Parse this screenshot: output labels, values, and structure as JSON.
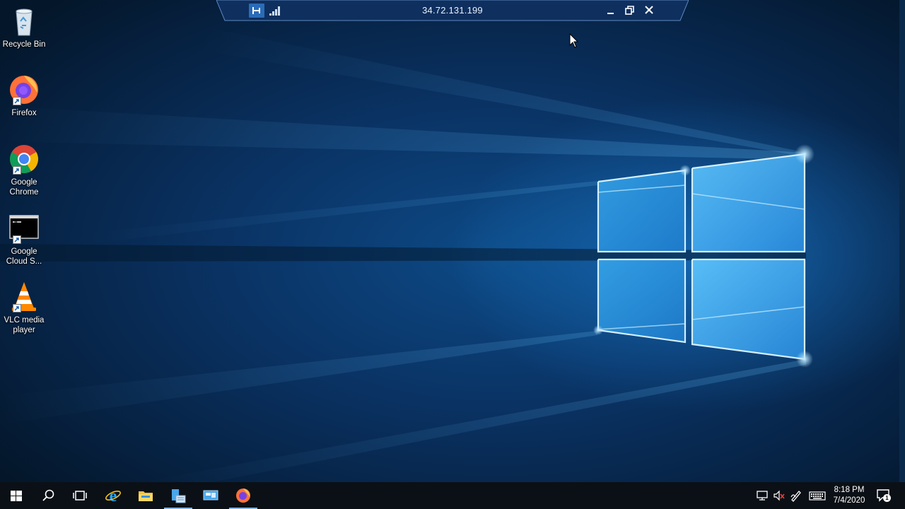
{
  "remote_bar": {
    "title": "34.72.131.199",
    "pin_icon": "pin-icon",
    "signal_icon": "connection-signal-icon",
    "buttons": [
      "minimize-icon",
      "restore-icon",
      "close-icon"
    ]
  },
  "desktop_icons": [
    {
      "label": "Recycle Bin",
      "icon": "recycle-bin-icon",
      "shortcut": false
    },
    {
      "label": "Firefox",
      "icon": "firefox-icon",
      "shortcut": true
    },
    {
      "label": "Google Chrome",
      "icon": "chrome-icon",
      "shortcut": true
    },
    {
      "label": "Google Cloud S...",
      "icon": "cloud-sdk-shell-icon",
      "shortcut": true
    },
    {
      "label": "VLC media player",
      "icon": "vlc-icon",
      "shortcut": true
    }
  ],
  "taskbar": {
    "items": [
      {
        "icon": "start-icon",
        "active": false
      },
      {
        "icon": "search-icon",
        "active": false
      },
      {
        "icon": "task-view-icon",
        "active": false
      },
      {
        "icon": "internet-explorer-icon",
        "active": false
      },
      {
        "icon": "file-explorer-icon",
        "active": false
      },
      {
        "icon": "server-manager-icon",
        "active": true
      },
      {
        "icon": "remote-desktop-icon",
        "active": false
      },
      {
        "icon": "firefox-icon",
        "active": true
      }
    ],
    "tray": [
      "network-icon",
      "volume-muted-icon",
      "pen-icon",
      "keyboard-icon"
    ],
    "time": "8:18 PM",
    "date": "7/4/2020",
    "notification_count": "1"
  },
  "colors": {
    "accent": "#2a6cb8",
    "taskbar": "#0b1016",
    "wallpaper_glow": "#35b5ff"
  }
}
